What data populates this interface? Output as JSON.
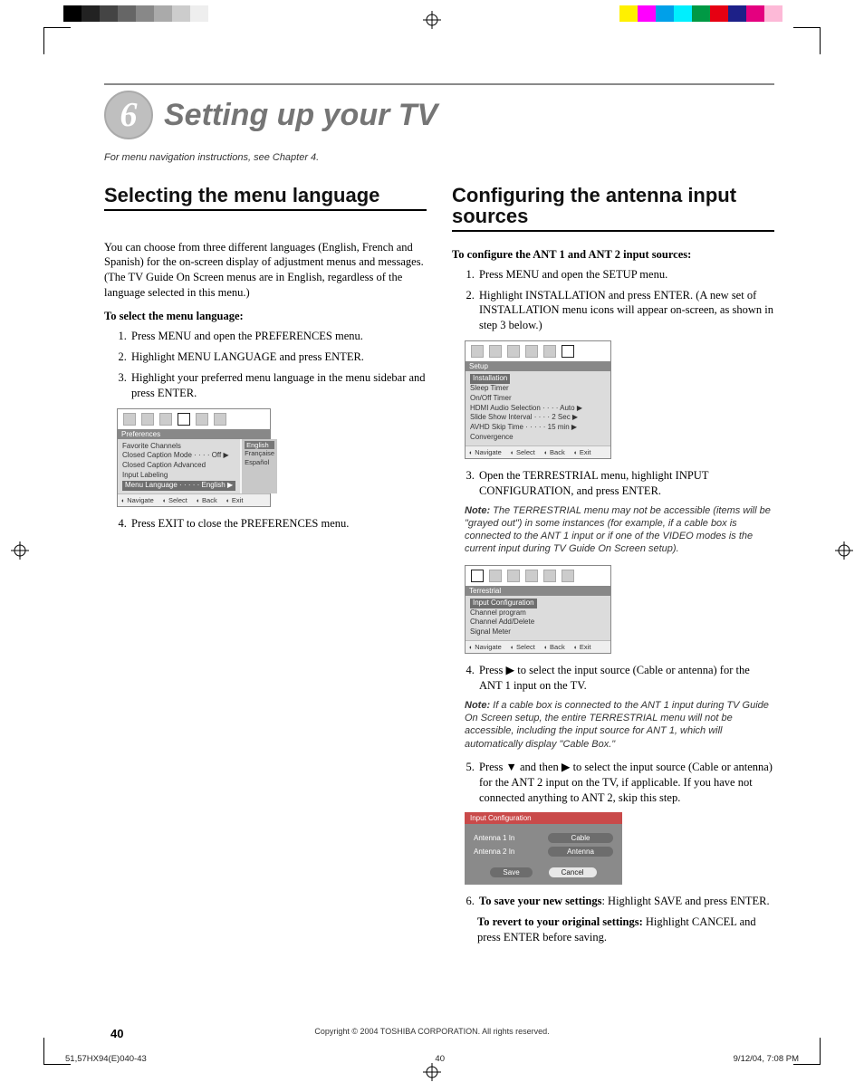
{
  "chapter": {
    "number": "6",
    "title": "Setting up your TV"
  },
  "nav_note": "For menu navigation instructions, see Chapter 4.",
  "left": {
    "section_title": "Selecting the menu language",
    "intro": "You can choose from three different languages (English, French and Spanish) for the on-screen display of adjustment menus and messages. (The TV Guide On Screen menus are in English, regardless of the language selected in this menu.)",
    "howto": "To select the menu language:",
    "steps": [
      "Press MENU and open the PREFERENCES menu.",
      "Highlight MENU LANGUAGE and press ENTER.",
      "Highlight your preferred menu language in the menu sidebar and press ENTER.",
      "Press EXIT to close the PREFERENCES menu."
    ],
    "ui": {
      "tab": "Preferences",
      "items": [
        "Favorite Channels",
        "Closed Caption Mode · · · · Off ▶",
        "Closed Caption Advanced",
        "Input Labeling",
        "Menu Language · · · · · English ▶"
      ],
      "langs": [
        "English",
        "Française",
        "Español"
      ],
      "ftr": [
        "Navigate",
        "Select",
        "Back",
        "Exit"
      ]
    }
  },
  "right": {
    "section_title": "Configuring the antenna input sources",
    "howto": "To configure the ANT 1 and ANT 2 input sources:",
    "steps_top": [
      "Press MENU and open the SETUP menu.",
      "Highlight INSTALLATION and press ENTER. (A new set of INSTALLATION menu icons will appear on-screen, as shown in step 3 below.)"
    ],
    "ui1": {
      "tab": "Setup",
      "items": [
        "Installation",
        "Sleep Timer",
        "On/Off Timer",
        "HDMI Audio Selection · · · · Auto ▶",
        "Slide Show Interval · · · · 2 Sec ▶",
        "AVHD Skip Time · · · · · 15 min ▶",
        "Convergence"
      ],
      "ftr": [
        "Navigate",
        "Select",
        "Back",
        "Exit"
      ]
    },
    "step3": "Open the TERRESTRIAL menu, highlight INPUT CONFIGURATION, and press ENTER.",
    "note1_label": "Note:",
    "note1": "The TERRESTRIAL menu may not be accessible (items will be \"grayed out\") in some instances (for example, if a cable box is connected to the ANT 1 input or if one of the VIDEO modes is the current input during TV Guide On Screen setup).",
    "ui2": {
      "tab": "Terrestrial",
      "items": [
        "Input Configuration",
        "Channel program",
        "Channel Add/Delete",
        "Signal Meter"
      ],
      "ftr": [
        "Navigate",
        "Select",
        "Back",
        "Exit"
      ]
    },
    "step4": "Press ▶ to select the input source (Cable or antenna) for the ANT 1 input on the TV.",
    "note2_label": "Note:",
    "note2": "If a cable box is connected to the ANT 1 input during TV Guide On Screen setup, the entire TERRESTRIAL menu will not be accessible, including the input source for ANT 1, which will automatically display \"Cable Box.\"",
    "step5": "Press ▼ and then ▶ to select the input source (Cable or antenna) for the ANT 2 input on the TV, if applicable. If you have not connected anything to ANT 2, skip this step.",
    "cfg": {
      "title": "Input Configuration",
      "ant1": "Antenna 1 In",
      "ant1v": "Cable",
      "ant2": "Antenna 2 In",
      "ant2v": "Antenna",
      "save": "Save",
      "cancel": "Cancel"
    },
    "step6_lead": "To save your new settings",
    "step6_tail": ": Highlight SAVE and press ENTER.",
    "revert_lead": "To revert to your original settings:",
    "revert_tail": " Highlight CANCEL and press ENTER before saving."
  },
  "page_number": "40",
  "copyright": "Copyright © 2004 TOSHIBA CORPORATION. All rights reserved.",
  "footer": {
    "file": "51,57HX94(E)040-43",
    "pg": "40",
    "date": "9/12/04, 7:08 PM"
  },
  "colors": {
    "left_bar": [
      "#000",
      "#222",
      "#444",
      "#666",
      "#888",
      "#aaa",
      "#ccc",
      "#eee",
      "#fff",
      "#fff"
    ],
    "right_bar": [
      "#fff000",
      "#ff00ff",
      "#00a0e9",
      "#00effe",
      "#009944",
      "#e60012",
      "#1d2088",
      "#e4007f",
      "#fdb9d7",
      "#fff"
    ]
  }
}
